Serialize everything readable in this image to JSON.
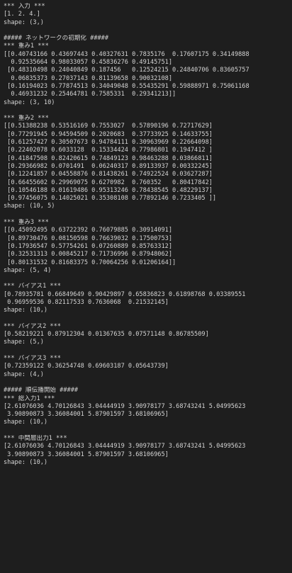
{
  "console": {
    "lines": [
      "*** 入力 ***",
      "[1. 2. 4.]",
      "shape: (3,)",
      "",
      "##### ネットワークの初期化 #####",
      "*** 重み1 ***",
      "[[0.40743166 0.43697443 0.40327631 0.7835176  0.17607175 0.34149888",
      "  0.92535664 0.98033057 0.45836276 0.49145751]",
      " [0.48310498 0.24040849 0.187456   0.12524215 0.24840706 0.83605757",
      "  0.06835373 0.27037143 0.81139658 0.90032108]",
      " [0.16194023 0.77874513 0.34049048 0.55435291 0.59888971 0.75061168",
      "  0.46931232 0.25464781 0.7585331  0.29341213]]",
      "shape: (3, 10)",
      "",
      "*** 重み2 ***",
      "[[0.51388238 0.53516169 0.7553027  0.57890196 0.72717629]",
      " [0.77291945 0.94594509 0.2020683  0.37733925 0.14633755]",
      " [0.61257427 0.30507673 0.94784111 0.30963969 0.22664098]",
      " [0.22402078 0.6033128  0.15334424 0.77986801 0.1947412 ]",
      " [0.41847508 0.82420615 0.74849123 0.98463288 0.03866811]",
      " [0.29366982 0.0701491  0.06240317 0.89133937 0.00332245]",
      " [0.12241857 0.04558876 0.81438261 0.74922524 0.03627287]",
      " [0.66455602 0.29969075 0.6270982  0.760352   0.80417842]",
      " [0.10546188 0.01619486 0.95313246 0.78438545 0.48229137]",
      " [0.97456075 0.14025021 0.35308108 0.77892146 0.7233405 ]]",
      "shape: (10, 5)",
      "",
      "*** 重み3 ***",
      "[[0.45092495 0.63722392 0.76079885 0.30914091]",
      " [0.89730476 0.08150598 0.76639032 0.17500753]",
      " [0.17936547 0.57754261 0.07260889 0.85763312]",
      " [0.32531313 0.00845217 0.71736996 0.87948062]",
      " [0.80131532 0.81683375 0.70064256 0.01206164]]",
      "shape: (5, 4)",
      "",
      "*** バイアス1 ***",
      "[0.78935781 0.66849649 0.90429897 0.65836823 0.61898768 0.03389551",
      " 0.96959536 0.82117533 0.7636068  0.21532145]",
      "shape: (10,)",
      "",
      "*** バイアス2 ***",
      "[0.58219221 0.87912304 0.01367635 0.07571148 0.86785509]",
      "shape: (5,)",
      "",
      "*** バイアス3 ***",
      "[0.72359122 0.36254748 0.69603187 0.05643739]",
      "shape: (4,)",
      "",
      "##### 順伝播開始 #####",
      "*** 総入力1 ***",
      "[2.61076036 4.70126843 3.04444919 3.90978177 3.68743241 5.04995623",
      " 3.90890873 3.36084001 5.87901597 3.68106965]",
      "shape: (10,)",
      "",
      "*** 中間層出力1 ***",
      "[2.61076036 4.70126843 3.04444919 3.90978177 3.68743241 5.04995623",
      " 3.90890873 3.36084001 5.87901597 3.68106965]",
      "shape: (10,)"
    ]
  }
}
